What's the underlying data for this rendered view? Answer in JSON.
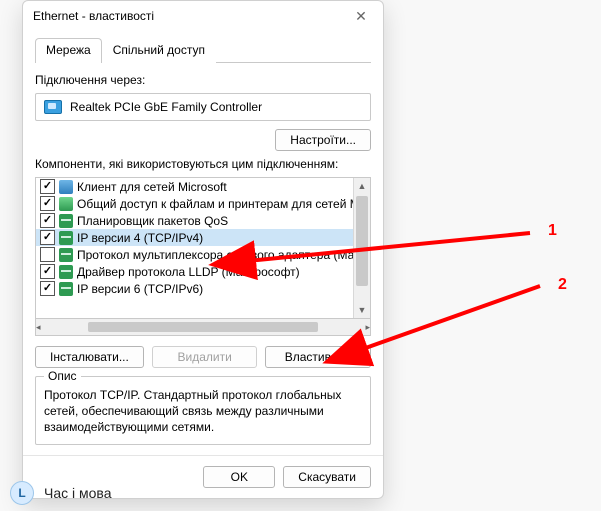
{
  "window": {
    "title": "Ethernet - властивості"
  },
  "tabs": {
    "network": "Мережа",
    "sharing": "Спільний доступ"
  },
  "connection": {
    "label": "Підключення через:",
    "adapter": "Realtek PCIe GbE Family Controller",
    "configure": "Настроїти..."
  },
  "components": {
    "label": "Компоненти, які використовуються цим підключенням:",
    "items": [
      {
        "checked": true,
        "icon": "ic-client",
        "label": "Клиент для сетей Microsoft",
        "selected": false
      },
      {
        "checked": true,
        "icon": "ic-share",
        "label": "Общий доступ к файлам и принтерам для сетей Mi",
        "selected": false
      },
      {
        "checked": true,
        "icon": "ic-proto",
        "label": "Планировщик пакетов QoS",
        "selected": false
      },
      {
        "checked": true,
        "icon": "ic-proto",
        "label": "IP версии 4 (TCP/IPv4)",
        "selected": true
      },
      {
        "checked": false,
        "icon": "ic-proto",
        "label": "Протокол мультиплексора сетевого адаптера (Ма",
        "selected": false
      },
      {
        "checked": true,
        "icon": "ic-proto",
        "label": "Драйвер протокола LLDP (Майкрософт)",
        "selected": false
      },
      {
        "checked": true,
        "icon": "ic-proto",
        "label": "IP версии 6 (TCP/IPv6)",
        "selected": false
      }
    ]
  },
  "buttons": {
    "install": "Інсталювати...",
    "uninstall": "Видалити",
    "properties": "Властивості",
    "ok": "OK",
    "cancel": "Скасувати"
  },
  "description": {
    "legend": "Опис",
    "text": "Протокол TCP/IP. Стандартный протокол глобальных сетей, обеспечивающий связь между различными взаимодействующими сетями."
  },
  "annotations": {
    "one": "1",
    "two": "2"
  },
  "colors": {
    "arrow": "#ff0000",
    "selection": "#cce4f7"
  },
  "bottom": {
    "label": "Час і мова",
    "icon_letter": "L"
  }
}
